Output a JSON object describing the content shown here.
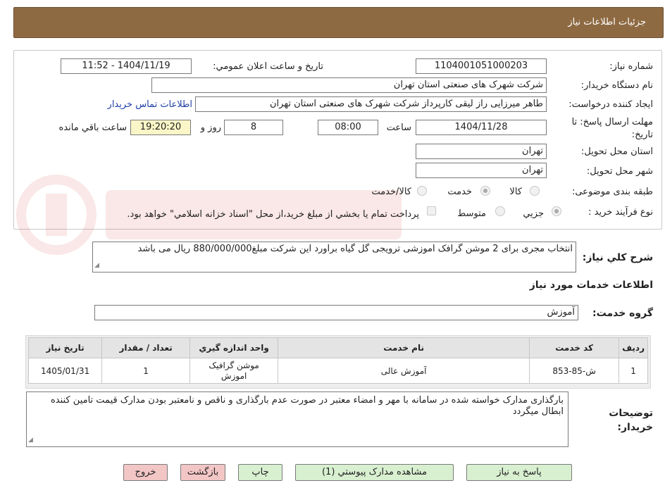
{
  "header": {
    "title": "جزئيات اطلاعات نياز"
  },
  "form": {
    "need_number_label": "شماره نياز:",
    "need_number": "1104001051000203",
    "announce_label": "تاريخ و ساعت اعلان عمومي:",
    "announce_value": "1404/11/19 - 11:52",
    "buyer_org_label": "نام دستگاه خريدار:",
    "buyer_org": "شرکت شهرک های صنعتی استان تهران",
    "requester_label": "ايجاد کننده درخواست:",
    "requester": "طاهر  میرزایی راز لیقی کارپرداز شرکت شهرک های صنعتی استان تهران",
    "contact_link": "اطلاعات تماس خريدار",
    "deadline_label": "مهلت ارسال پاسخ: تا تاريخ:",
    "deadline_date": "1404/11/28",
    "time_label": "ساعت",
    "deadline_time": "08:00",
    "days_value": "8",
    "days_label": "روز و",
    "remaining_time": "19:20:20",
    "remaining_label": "ساعت باقي مانده",
    "province_label": "استان محل تحويل:",
    "province": "تهران",
    "city_label": "شهر محل تحويل:",
    "city": "تهران",
    "category_label": "طبقه بندی موضوعی:",
    "category_options": [
      "کالا",
      "خدمت",
      "کالا/خدمت"
    ],
    "category_selected": "خدمت",
    "process_label": "نوع فرآيند خريد :",
    "process_options": [
      "جزيي",
      "متوسط"
    ],
    "process_selected": "جزيي",
    "payment_note": "پرداخت تمام يا بخشي از مبلغ خريد،از محل \"اسناد خزانه اسلامي\" خواهد بود."
  },
  "summary": {
    "label": "شرح کلي نياز:",
    "text": "انتخاب مجری برای 2 موشن گرافک اموزشی ترویجی گل گیاه  براورد این شرکت مبلغ880/000/000 ریال می باشد"
  },
  "services": {
    "title": "اطلاعات خدمات مورد نياز",
    "group_label": "گروه خدمت:",
    "group_value": "آموزش",
    "columns": [
      "رديف",
      "کد خدمت",
      "نام خدمت",
      "واحد اندازه گيري",
      "تعداد / مقدار",
      "تاريخ نياز"
    ],
    "rows": [
      [
        "1",
        "ش-85-853",
        "آموزش عالی",
        "موشن گرافیک اموزش",
        "1",
        "1405/01/31"
      ]
    ]
  },
  "buyer_notes": {
    "label": "توضيحات خريدار:",
    "text": "بارگذاری مدارک خواسته شده در سامانه با مهر و امضاء معتبر در صورت عدم بارگذاری و ناقص و نامعتبر بودن مدارک قیمت تامین کننده ابطال میگردد"
  },
  "buttons": {
    "reply": "پاسخ به نياز",
    "attachments": "مشاهده مدارک پيوستي (1)",
    "print": "چاپ",
    "back": "بازگشت",
    "exit": "خروج"
  },
  "colors": {
    "header_bg": "#8e6a43",
    "accent_green": "#d8f0d0",
    "accent_pink": "#f3c6c6",
    "highlight_yellow": "#fbf6c7",
    "link": "#1f3ea8"
  }
}
